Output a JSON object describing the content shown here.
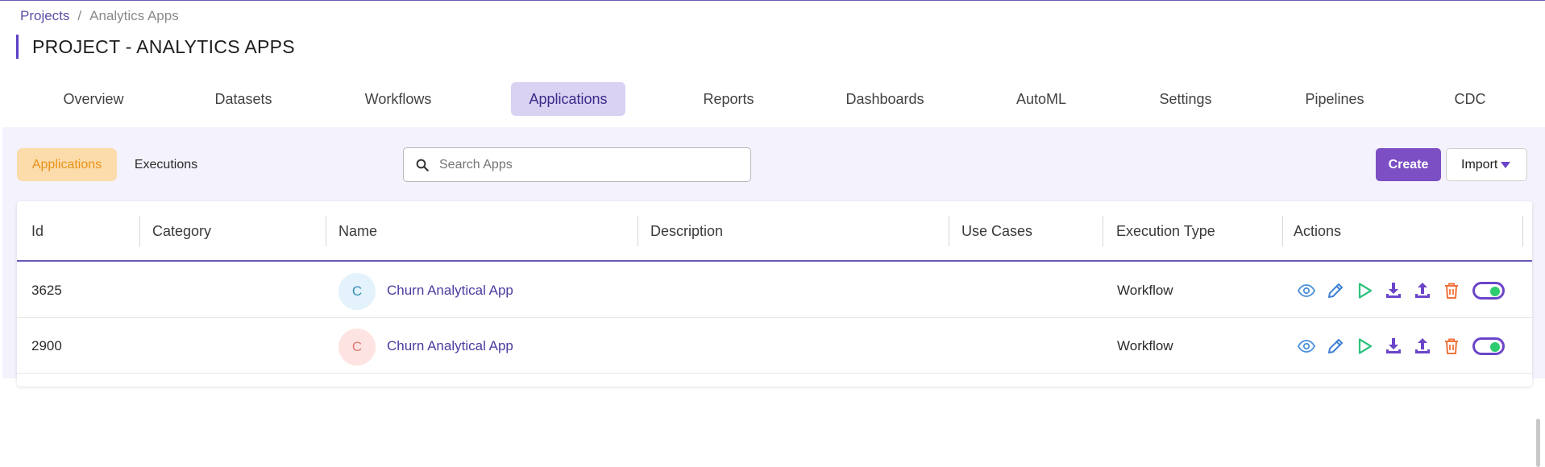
{
  "breadcrumb": {
    "root": "Projects",
    "separator": "/",
    "current": "Analytics Apps"
  },
  "page_title": "PROJECT - ANALYTICS APPS",
  "tabs": [
    {
      "label": "Overview"
    },
    {
      "label": "Datasets"
    },
    {
      "label": "Workflows"
    },
    {
      "label": "Applications",
      "active": true
    },
    {
      "label": "Reports"
    },
    {
      "label": "Dashboards"
    },
    {
      "label": "AutoML"
    },
    {
      "label": "Settings"
    },
    {
      "label": "Pipelines"
    },
    {
      "label": "CDC"
    }
  ],
  "subtabs": {
    "applications": "Applications",
    "executions": "Executions"
  },
  "search": {
    "placeholder": "Search Apps",
    "value": ""
  },
  "buttons": {
    "create": "Create",
    "import": "Import"
  },
  "table": {
    "columns": [
      "Id",
      "Category",
      "Name",
      "Description",
      "Use Cases",
      "Execution Type",
      "Actions"
    ],
    "rows": [
      {
        "id": "3625",
        "category": "",
        "avatar_letter": "C",
        "avatar_color": "#e3f2fb",
        "avatar_text_color": "#3a8fb7",
        "name": "Churn Analytical App",
        "description": "",
        "use_cases": "",
        "execution_type": "Workflow"
      },
      {
        "id": "2900",
        "category": "",
        "avatar_letter": "C",
        "avatar_color": "#fde4e2",
        "avatar_text_color": "#e77a70",
        "name": "Churn Analytical App",
        "description": "",
        "use_cases": "",
        "execution_type": "Workflow"
      }
    ]
  },
  "action_icons": [
    "eye-icon",
    "pencil-icon",
    "play-icon",
    "download-icon",
    "upload-icon",
    "trash-icon",
    "toggle-switch"
  ],
  "colors": {
    "accent": "#7c4fc4",
    "active_tab_bg": "#d9d2f2",
    "subtab_active_bg": "#fcdcaa",
    "workspace_bg": "#f4f2fc"
  }
}
